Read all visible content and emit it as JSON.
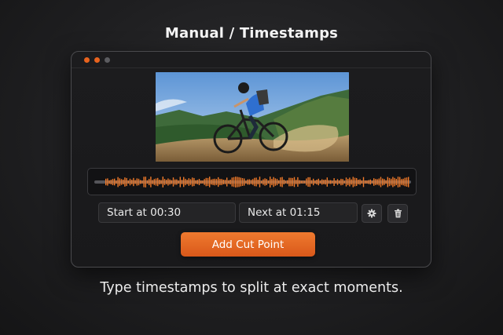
{
  "page": {
    "heading": "Manual / Timestamps",
    "caption": "Type timestamps to split at exact moments."
  },
  "window": {
    "controls": [
      {
        "name": "window-dot-1",
        "color": "#e8631e"
      },
      {
        "name": "window-dot-2",
        "color": "#e8631e"
      },
      {
        "name": "window-dot-3",
        "color": "#5c5c60"
      }
    ]
  },
  "timeline": {
    "waveform_color": "#f07a2a",
    "track_color": "#55555a"
  },
  "inputs": {
    "start": "Start at 00:30",
    "next": "Next at 01:15"
  },
  "actions": {
    "settings_icon": "gear-icon",
    "delete_icon": "trash-icon",
    "add_cut_label": "Add Cut Point"
  },
  "colors": {
    "accent": "#e8631e",
    "background": "#1f1f21"
  }
}
